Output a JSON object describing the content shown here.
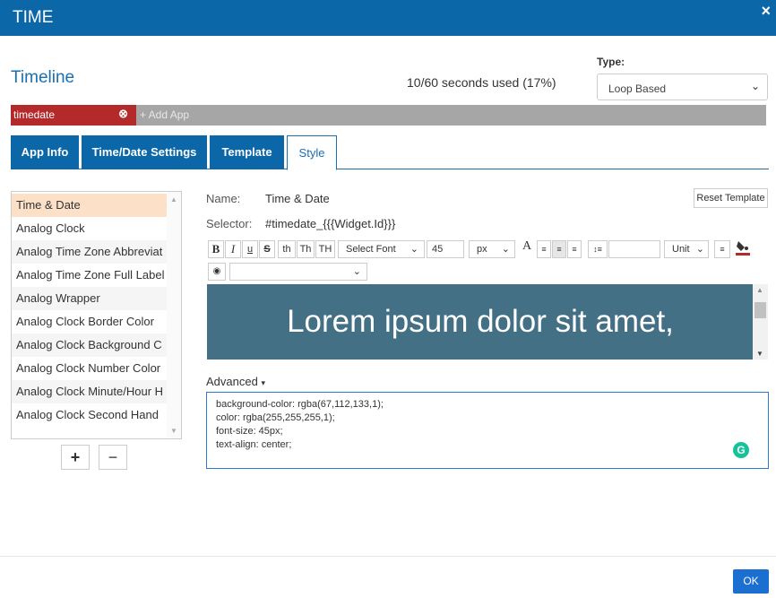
{
  "dialog": {
    "title": "TIME",
    "close_icon": "×"
  },
  "timeline": {
    "label": "Timeline",
    "seconds_used": "10/60 seconds used (17%)"
  },
  "type": {
    "label": "Type:",
    "selected": "Loop Based"
  },
  "apps": {
    "tag_name": "timedate",
    "add_label": "+ Add App"
  },
  "tabs": [
    {
      "label": "App Info"
    },
    {
      "label": "Time/Date Settings"
    },
    {
      "label": "Template"
    },
    {
      "label": "Style"
    }
  ],
  "style_list": [
    "Time & Date",
    "Analog Clock",
    "Analog Time Zone Abbreviat",
    "Analog Time Zone Full Label",
    "Analog Wrapper",
    "Analog Clock Border Color",
    "Analog Clock Background C",
    "Analog Clock Number Color",
    "Analog Clock Minute/Hour H",
    "Analog Clock Second Hand"
  ],
  "list_buttons": {
    "add": "+",
    "remove": "−"
  },
  "detail": {
    "name_label": "Name:",
    "name_value": "Time & Date",
    "selector_label": "Selector:",
    "selector_value": "#timedate_{{{Widget.Id}}}",
    "reset_label": "Reset Template"
  },
  "toolbar": {
    "bold": "B",
    "italic": "I",
    "underline": "u",
    "strike": "S",
    "th1": "th",
    "th2": "Th",
    "th3": "TH",
    "font_select": "Select Font",
    "font_size": "45",
    "unit_px": "px",
    "unit_select": "Unit"
  },
  "preview": {
    "text": "Lorem ipsum dolor sit amet,",
    "bg_color": "#437085"
  },
  "advanced": {
    "label": "Advanced",
    "lines": [
      "background-color: rgba(67,112,133,1);",
      "color: rgba(255,255,255,1);",
      "font-size: 45px;",
      "text-align: center;"
    ]
  },
  "footer": {
    "ok_label": "OK"
  },
  "colors": {
    "header": "#0b67a8",
    "tag": "#b42a2a",
    "selected_item": "#fde0c8"
  }
}
